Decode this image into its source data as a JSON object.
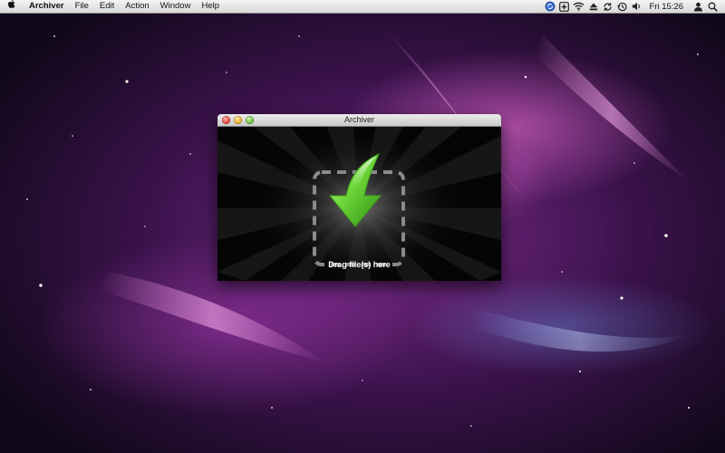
{
  "menubar": {
    "apple_icon": "apple-icon",
    "items": [
      "Archiver",
      "File",
      "Edit",
      "Action",
      "Window",
      "Help"
    ],
    "status_icons": [
      "sync-icon",
      "plus-box-icon",
      "wifi-icon",
      "eject-icon",
      "refresh-icon",
      "time-machine-icon",
      "volume-icon"
    ],
    "clock": "Fri 15:26",
    "user_icon": "user-icon",
    "spotlight_icon": "search-icon"
  },
  "window": {
    "title": "Archiver",
    "drop_label": "Drag file(s) here",
    "accent": "#4cc81e"
  }
}
